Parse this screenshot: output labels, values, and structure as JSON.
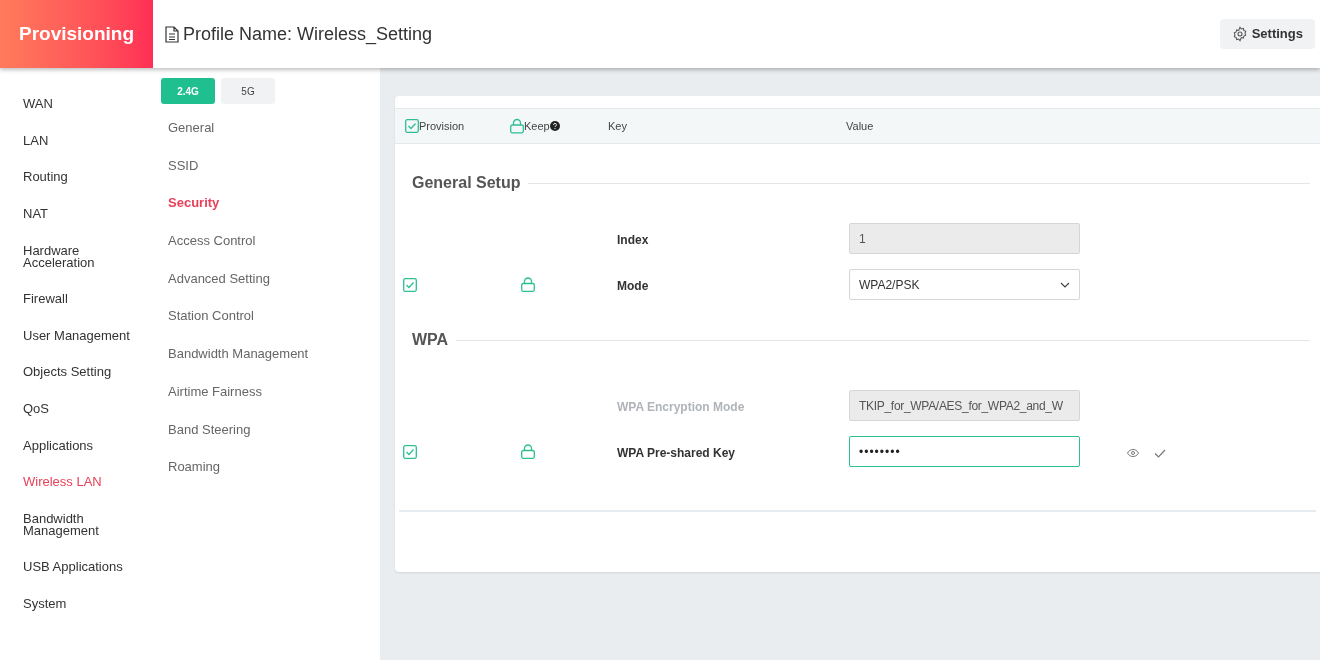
{
  "header": {
    "app_title": "Provisioning",
    "profile_title": "Profile Name: Wireless_Setting",
    "settings_button": "Settings"
  },
  "sidebar": {
    "items": [
      {
        "label": "WAN",
        "selected": false
      },
      {
        "label": "LAN",
        "selected": false
      },
      {
        "label": "Routing",
        "selected": false
      },
      {
        "label": "NAT",
        "selected": false
      },
      {
        "label": "Hardware Acceleration",
        "selected": false
      },
      {
        "label": "Firewall",
        "selected": false
      },
      {
        "label": "User Management",
        "selected": false
      },
      {
        "label": "Objects Setting",
        "selected": false
      },
      {
        "label": "QoS",
        "selected": false
      },
      {
        "label": "Applications",
        "selected": false
      },
      {
        "label": "Wireless LAN",
        "selected": true
      },
      {
        "label": "Bandwidth Management",
        "selected": false
      },
      {
        "label": "USB Applications",
        "selected": false
      },
      {
        "label": "System",
        "selected": false
      }
    ]
  },
  "band_tabs": [
    {
      "label": "2.4G",
      "selected": true
    },
    {
      "label": "5G",
      "selected": false
    }
  ],
  "subnav": {
    "items": [
      {
        "label": "General",
        "selected": false
      },
      {
        "label": "SSID",
        "selected": false
      },
      {
        "label": "Security",
        "selected": true
      },
      {
        "label": "Access Control",
        "selected": false
      },
      {
        "label": "Advanced Setting",
        "selected": false
      },
      {
        "label": "Station Control",
        "selected": false
      },
      {
        "label": "Bandwidth Management",
        "selected": false
      },
      {
        "label": "Airtime Fairness",
        "selected": false
      },
      {
        "label": "Band Steering",
        "selected": false
      },
      {
        "label": "Roaming",
        "selected": false
      }
    ]
  },
  "table": {
    "columns": [
      "Provision",
      "Keep",
      "Key",
      "Value"
    ],
    "sections": [
      {
        "title": "General Setup",
        "rows": [
          {
            "key": "Index",
            "kind": "readonly",
            "value": "1",
            "provision": false,
            "keep": false,
            "disabled": false
          },
          {
            "key": "Mode",
            "kind": "select",
            "value": "WPA2/PSK",
            "provision": true,
            "keep": true,
            "disabled": false
          }
        ]
      },
      {
        "title": "WPA",
        "rows": [
          {
            "key": "WPA Encryption Mode",
            "kind": "readonly",
            "value": "TKIP_for_WPA/AES_for_WPA2_and_W",
            "provision": false,
            "keep": false,
            "disabled": true
          },
          {
            "key": "WPA Pre-shared Key",
            "kind": "password",
            "value": "••••••••",
            "provision": true,
            "keep": true,
            "disabled": false
          }
        ]
      }
    ]
  }
}
